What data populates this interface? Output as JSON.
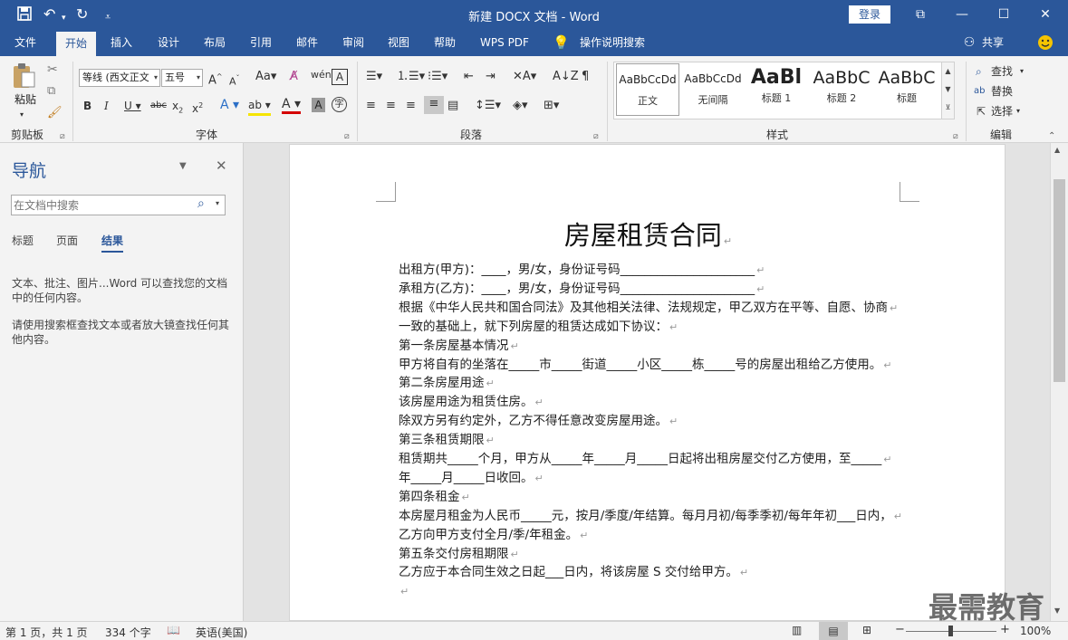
{
  "window": {
    "title": "新建 DOCX 文档  -  Word",
    "login_label": "登录",
    "min_glyph": "—",
    "max_glyph": "☐",
    "close_glyph": "✕",
    "restore_glyph": "⧉"
  },
  "quick_access": {
    "save_icon": "save-icon",
    "undo_icon": "undo-icon",
    "redo_icon": "redo-icon",
    "more_icon": "customize-icon"
  },
  "tabs": [
    {
      "label": "文件"
    },
    {
      "label": "开始",
      "active": true
    },
    {
      "label": "插入"
    },
    {
      "label": "设计"
    },
    {
      "label": "布局"
    },
    {
      "label": "引用"
    },
    {
      "label": "邮件"
    },
    {
      "label": "审阅"
    },
    {
      "label": "视图"
    },
    {
      "label": "帮助"
    },
    {
      "label": "WPS PDF"
    },
    {
      "label": "操作说明搜索"
    }
  ],
  "share_label": "共享",
  "ribbon": {
    "clipboard": {
      "paste_label": "粘贴",
      "group_label": "剪贴板"
    },
    "font": {
      "font_name": "等线 (西文正文",
      "font_size": "五号",
      "group_label": "字体"
    },
    "paragraph": {
      "group_label": "段落"
    },
    "styles": {
      "group_label": "样式",
      "items": [
        {
          "preview": "AaBbCcDd",
          "name": "正文"
        },
        {
          "preview": "AaBbCcDd",
          "name": "无间隔"
        },
        {
          "preview": "AaBl",
          "name": "标题 1"
        },
        {
          "preview": "AaBbC",
          "name": "标题 2"
        },
        {
          "preview": "AaBbC",
          "name": "标题"
        }
      ]
    },
    "editing": {
      "find_label": "查找",
      "replace_label": "替换",
      "select_label": "选择",
      "group_label": "编辑"
    }
  },
  "nav": {
    "title": "导航",
    "search_placeholder": "在文档中搜索",
    "tabs": [
      {
        "label": "标题"
      },
      {
        "label": "页面"
      },
      {
        "label": "结果",
        "active": true
      }
    ],
    "hint1": "文本、批注、图片...Word 可以查找您的文档中的任何内容。",
    "hint2": "请使用搜索框查找文本或者放大镜查找任何其他内容。"
  },
  "document": {
    "title": "房屋租赁合同",
    "lines": [
      "出租方(甲方)：____，男/女，身份证号码______________________",
      "承租方(乙方)：____，男/女，身份证号码______________________",
      "根据《中华人民共和国合同法》及其他相关法律、法规规定，甲乙双方在平等、自愿、协商",
      "一致的基础上，就下列房屋的租赁达成如下协议：",
      "第一条房屋基本情况",
      "甲方将自有的坐落在_____市_____街道_____小区_____栋_____号的房屋出租给乙方使用。",
      "第二条房屋用途",
      "该房屋用途为租赁住房。",
      "除双方另有约定外，乙方不得任意改变房屋用途。",
      "第三条租赁期限",
      "租赁期共_____个月，甲方从_____年_____月_____日起将出租房屋交付乙方使用，至_____",
      "年_____月_____日收回。",
      "第四条租金",
      "本房屋月租金为人民币_____元，按月/季度/年结算。每月月初/每季季初/每年年初___日内，",
      "乙方向甲方支付全月/季/年租金。",
      "第五条交付房租期限",
      "乙方应于本合同生效之日起___日内，将该房屋 S 交付给甲方。",
      ""
    ],
    "para_mark": "↵"
  },
  "status": {
    "page_info": "第 1 页，共 1 页",
    "word_count": "334 个字",
    "language": "英语(美国)",
    "zoom": "100%"
  },
  "watermark": "最需教育",
  "colors": {
    "accent": "#2b579a"
  }
}
